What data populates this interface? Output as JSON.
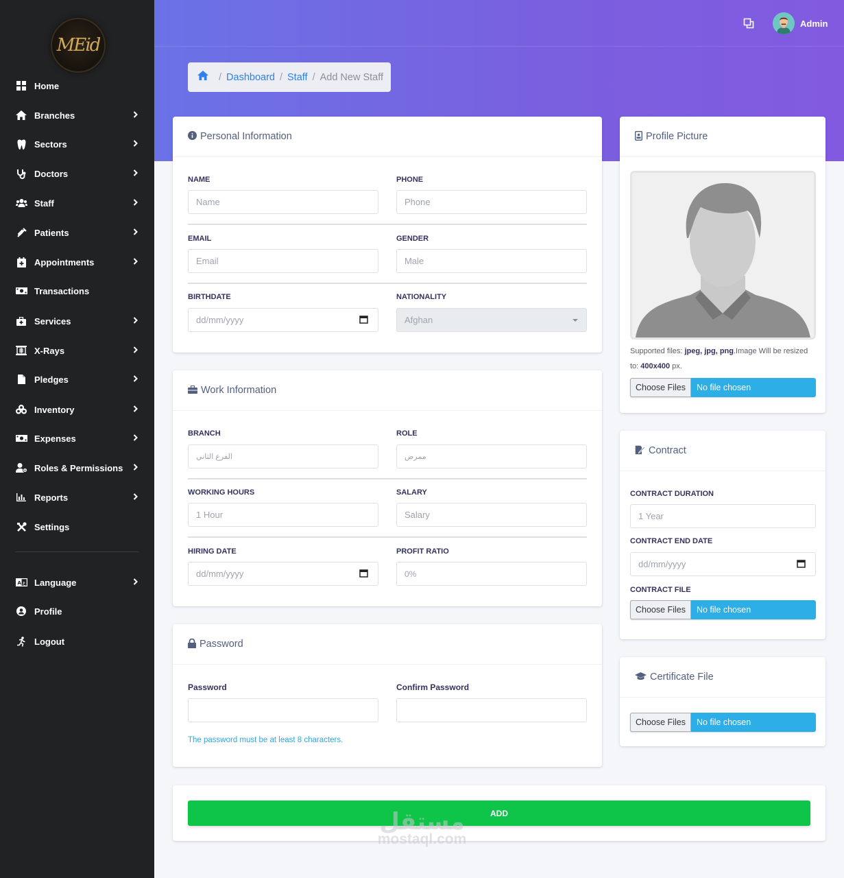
{
  "logo": {
    "text": "MEid"
  },
  "sidebar": {
    "items": [
      {
        "label": "Home",
        "icon": "grid-icon",
        "chevron": false
      },
      {
        "label": "Branches",
        "icon": "house-icon",
        "chevron": true
      },
      {
        "label": "Sectors",
        "icon": "tooth-icon",
        "chevron": true
      },
      {
        "label": "Doctors",
        "icon": "stethoscope-icon",
        "chevron": true
      },
      {
        "label": "Staff",
        "icon": "users-icon",
        "chevron": true
      },
      {
        "label": "Patients",
        "icon": "syringe-icon",
        "chevron": true
      },
      {
        "label": "Appointments",
        "icon": "calendar-plus-icon",
        "chevron": true
      },
      {
        "label": "Transactions",
        "icon": "money-icon",
        "chevron": false
      },
      {
        "label": "Services",
        "icon": "medkit-icon",
        "chevron": true
      },
      {
        "label": "X-Rays",
        "icon": "xray-icon",
        "chevron": true
      },
      {
        "label": "Pledges",
        "icon": "file-icon",
        "chevron": true
      },
      {
        "label": "Inventory",
        "icon": "boxes-icon",
        "chevron": true
      },
      {
        "label": "Expenses",
        "icon": "money-icon",
        "chevron": true
      },
      {
        "label": "Roles & Permissions",
        "icon": "user-gear-icon",
        "chevron": true
      },
      {
        "label": "Reports",
        "icon": "bar-chart-icon",
        "chevron": true
      },
      {
        "label": "Settings",
        "icon": "tools-icon",
        "chevron": false
      }
    ],
    "bottom_items": [
      {
        "label": "Language",
        "icon": "language-icon",
        "chevron": true
      },
      {
        "label": "Profile",
        "icon": "user-circle-icon",
        "chevron": false
      },
      {
        "label": "Logout",
        "icon": "running-icon",
        "chevron": false
      }
    ]
  },
  "header": {
    "user_name": "Admin"
  },
  "breadcrumb": {
    "items": [
      "Dashboard",
      "Staff"
    ],
    "active": "Add New Staff"
  },
  "personal": {
    "title": "Personal Information",
    "name_label": "NAME",
    "name_placeholder": "Name",
    "phone_label": "PHONE",
    "phone_placeholder": "Phone",
    "email_label": "EMAIL",
    "email_placeholder": "Email",
    "gender_label": "GENDER",
    "gender_value": "Male",
    "birthdate_label": "BIRTHDATE",
    "birthdate_placeholder": "dd/mm/yyyy",
    "nationality_label": "NATIONALITY",
    "nationality_value": "Afghan"
  },
  "work": {
    "title": "Work Information",
    "branch_label": "BRANCH",
    "branch_value": "الفرع الثاني",
    "role_label": "ROLE",
    "role_value": "ممرض",
    "hours_label": "WORKING HOURS",
    "hours_value": "1 Hour",
    "salary_label": "SALARY",
    "salary_placeholder": "Salary",
    "hiring_label": "HIRING DATE",
    "hiring_placeholder": "dd/mm/yyyy",
    "profit_label": "PROFIT RATIO",
    "profit_value": "0%"
  },
  "password": {
    "title": "Password",
    "password_label": "Password",
    "confirm_label": "Confirm Password",
    "hint": "The password must be at least 8 characters."
  },
  "profile_picture": {
    "title": "Profile Picture",
    "support_prefix": "Supported files: ",
    "support_types": "jpeg, jpg, png",
    "support_mid": ".Image Will be resized to: ",
    "support_size": "400x400",
    "support_suffix": " px."
  },
  "contract": {
    "title": "Contract",
    "duration_label": "CONTRACT DURATION",
    "duration_value": "1 Year",
    "end_label": "CONTRACT END DATE",
    "end_placeholder": "dd/mm/yyyy",
    "file_label": "CONTRACT FILE"
  },
  "certificate": {
    "title": "Certificate File"
  },
  "file_input": {
    "choose": "Choose Files",
    "none": "No file chosen"
  },
  "actions": {
    "add": "ADD"
  },
  "watermark": {
    "arabic": "مستقل",
    "latin": "mostaql.com"
  }
}
